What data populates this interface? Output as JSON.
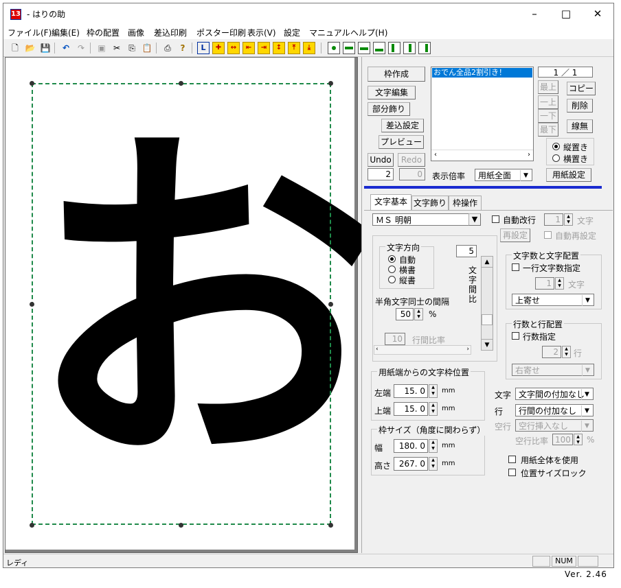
{
  "window": {
    "title": "- はりの助",
    "icon": "13"
  },
  "menu": [
    "ファイル(F)",
    "編集(E)",
    "枠の配置",
    "画像",
    "差込印刷",
    "ポスター印刷",
    "表示(V)",
    "設定",
    "マニュアル",
    "ヘルプ(H)"
  ],
  "canvas": {
    "character": "お"
  },
  "panel": {
    "create_frame": "枠作成",
    "edit_text": "文字編集",
    "partial_deco": "部分飾り",
    "merge_settings": "差込設定",
    "preview": "プレビュー",
    "undo": "Undo",
    "redo": "Redo",
    "list_items": [
      "おでん全品2割引き！"
    ],
    "page_counter": "1 ／ 1",
    "move_top": "最上",
    "move_up": "一上",
    "move_down": "一下",
    "move_bottom": "最下",
    "copy": "コピー",
    "delete": "削除",
    "no_line": "線無",
    "portrait": "縦置き",
    "landscape": "横置き",
    "num_left": "2",
    "num_right": "0",
    "zoom_label": "表示倍率",
    "zoom_value": "用紙全面",
    "paper_settings": "用紙設定"
  },
  "tabs": [
    "文字基本",
    "文字飾り",
    "枠操作"
  ],
  "text_basic": {
    "font": "ＭＳ 明朝",
    "auto_wrap": "自動改行",
    "auto_wrap_value": "1",
    "char_unit": "文字",
    "reset": "再設定",
    "auto_reset": "自動再設定",
    "direction_title": "文字方向",
    "dir_auto": "自動",
    "dir_horizontal": "横書",
    "dir_vertical": "縦書",
    "char_spacing_value": "5",
    "char_spacing_label": "文字間比率",
    "halfwidth_label": "半角文字同士の間隔",
    "halfwidth_value": "50",
    "percent": "%",
    "line_ratio_value": "10",
    "line_ratio_label": "行間比率",
    "chars_group": "文字数と文字配置",
    "chars_per_line": "一行文字数指定",
    "chars_value": "1",
    "align_value": "上寄せ",
    "lines_group": "行数と行配置",
    "line_count": "行数指定",
    "line_count_value": "2",
    "line_unit": "行",
    "line_align": "右寄せ",
    "pos_group": "用紙端からの文字枠位置",
    "left_label": "左端",
    "left_value": "15. 0",
    "top_label": "上端",
    "top_value": "15. 0",
    "mm": "mm",
    "size_group": "枠サイズ（角度に関わらず）",
    "width_label": "幅",
    "width_value": "180. 0",
    "height_label": "高さ",
    "height_value": "267. 0",
    "text_label": "文字",
    "text_option": "文字間の付加なし",
    "row_label": "行",
    "row_option": "行間の付加なし",
    "blank_label": "空行",
    "blank_option": "空行挿入なし",
    "blank_ratio_label": "空行比率",
    "blank_ratio_value": "100",
    "use_whole_paper": "用紙全体を使用",
    "lock_position": "位置サイズロック"
  },
  "status": {
    "text": "レディ",
    "num": "NUM"
  },
  "version": "Ver. 2.46"
}
